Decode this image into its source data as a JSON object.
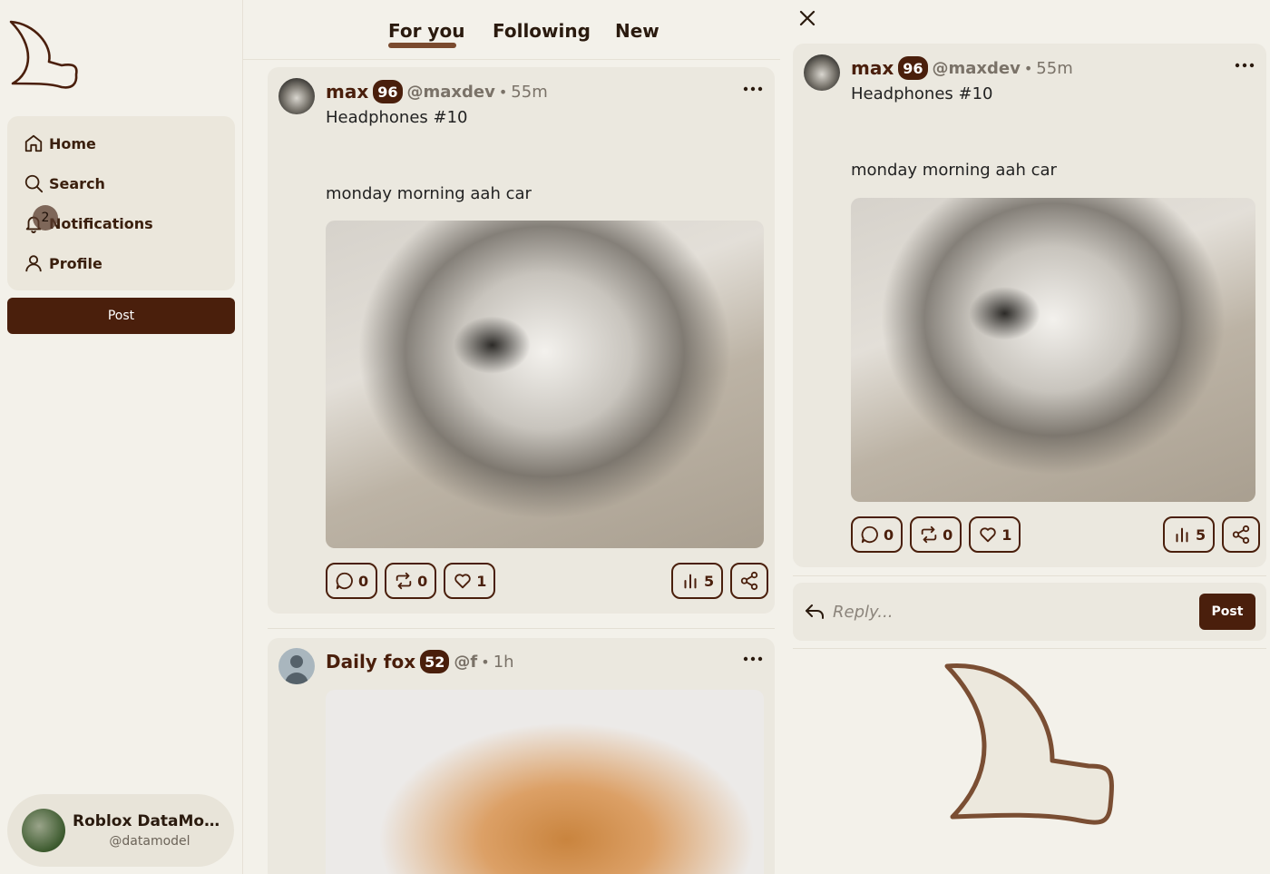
{
  "colors": {
    "accent": "#4a1f0c",
    "background": "#f3f1ea",
    "card": "#ebe8df",
    "nav_bg": "#ebe7dc"
  },
  "sidebar": {
    "logo_icon": "hat-logo-icon",
    "items": [
      {
        "label": "Home",
        "icon": "home-icon"
      },
      {
        "label": "Search",
        "icon": "search-icon"
      },
      {
        "label": "Notifications",
        "icon": "bell-icon",
        "badge": "2"
      },
      {
        "label": "Profile",
        "icon": "user-icon"
      }
    ],
    "post_label": "Post",
    "profile": {
      "name": "Roblox DataMod...",
      "handle": "@datamodel"
    }
  },
  "feed": {
    "tabs": [
      "For you",
      "Following",
      "New"
    ],
    "active_tab": "For you",
    "posts": [
      {
        "name": "max",
        "karma": "96",
        "handle": "@maxdev",
        "time": "55m",
        "text": "Headphones #10\n\n\nmonday morning aah car",
        "comments": "0",
        "reposts": "0",
        "likes": "1",
        "views": "5"
      },
      {
        "name": "Daily fox",
        "karma": "52",
        "handle": "@f",
        "time": "1h"
      }
    ]
  },
  "detail": {
    "post": {
      "name": "max",
      "karma": "96",
      "handle": "@maxdev",
      "time": "55m",
      "text": "Headphones #10\n\n\nmonday morning aah car",
      "comments": "0",
      "reposts": "0",
      "likes": "1",
      "views": "5"
    },
    "reply_placeholder": "Reply...",
    "reply_post_label": "Post"
  }
}
